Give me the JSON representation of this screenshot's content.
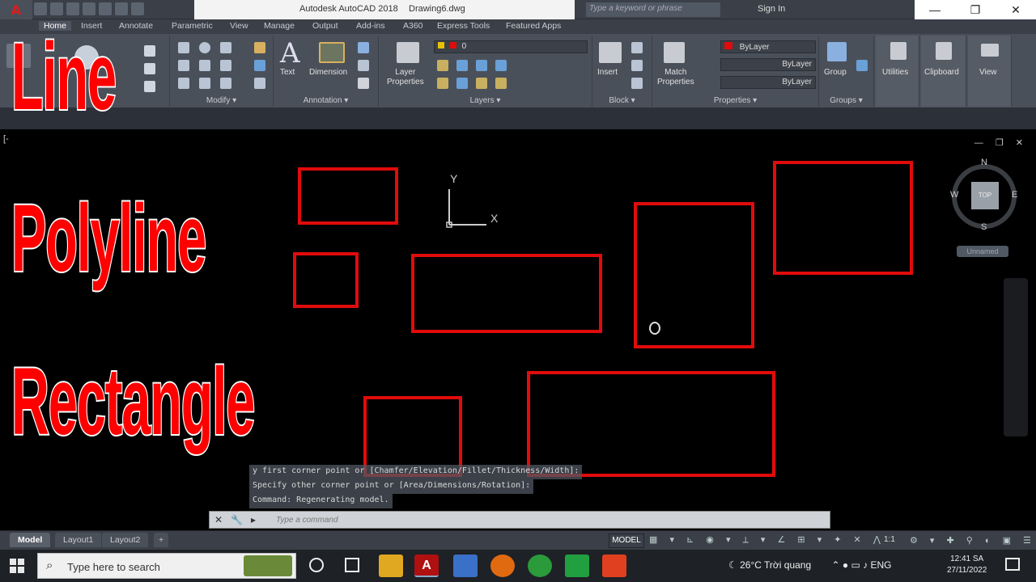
{
  "window": {
    "app_title": "Autodesk AutoCAD 2018",
    "document": "Drawing6.dwg",
    "search_placeholder": "Type a keyword or phrase",
    "sign_in": "Sign In",
    "minimize": "—",
    "restore": "❐",
    "close": "✕"
  },
  "app_button": "A",
  "ribbon_tabs": [
    "Home",
    "Insert",
    "Annotate",
    "Parametric",
    "View",
    "Manage",
    "Output",
    "Add-ins",
    "A360",
    "Express Tools",
    "Featured Apps"
  ],
  "ribbon": {
    "draw_partial": [
      "Li",
      "Pol"
    ],
    "modify_title": "Modify ▾",
    "text_label": "Text",
    "dimension_label": "Dimension",
    "annotation_title": "Annotation ▾",
    "layer_properties": "Layer\nProperties",
    "layer_value": "0",
    "layers_title": "Layers ▾",
    "insert_label": "Insert",
    "block_title": "Block ▾",
    "match_properties": "Match\nProperties",
    "color_value": "ByLayer",
    "linetype_value": "ByLayer",
    "lineweight_value": "ByLayer",
    "properties_title": "Properties ▾",
    "group_label": "Group",
    "groups_title": "Groups ▾",
    "utilities": "Utilities",
    "clipboard": "Clipboard",
    "view": "View"
  },
  "viewport": {
    "label": "[-",
    "ucs_x": "X",
    "ucs_y": "Y",
    "compass": {
      "n": "N",
      "s": "S",
      "e": "E",
      "w": "W",
      "top": "TOP"
    },
    "unnamed": "Unnamed"
  },
  "command_history": [
    "y first corner point or [Chamfer/Elevation/Fillet/Thickness/Width]:",
    "Specify other corner point or [Area/Dimensions/Rotation]:",
    "Command: Regenerating model."
  ],
  "command_placeholder": "Type a command",
  "layout_tabs": [
    "Model",
    "Layout1",
    "Layout2",
    "+"
  ],
  "status": {
    "model": "MODEL",
    "scale": "1:1"
  },
  "overlay_text": [
    "Line",
    "Polyline",
    "Rectangle"
  ],
  "taskbar": {
    "search": "Type here to search",
    "weather": "26°C  Trời quang",
    "lang": "ENG",
    "time": "12:41 SA",
    "date": "27/11/2022"
  },
  "colors": {
    "accent_red": "#e10b0b",
    "ribbon": "#4a505a",
    "titlebar": "#3a3f48"
  }
}
